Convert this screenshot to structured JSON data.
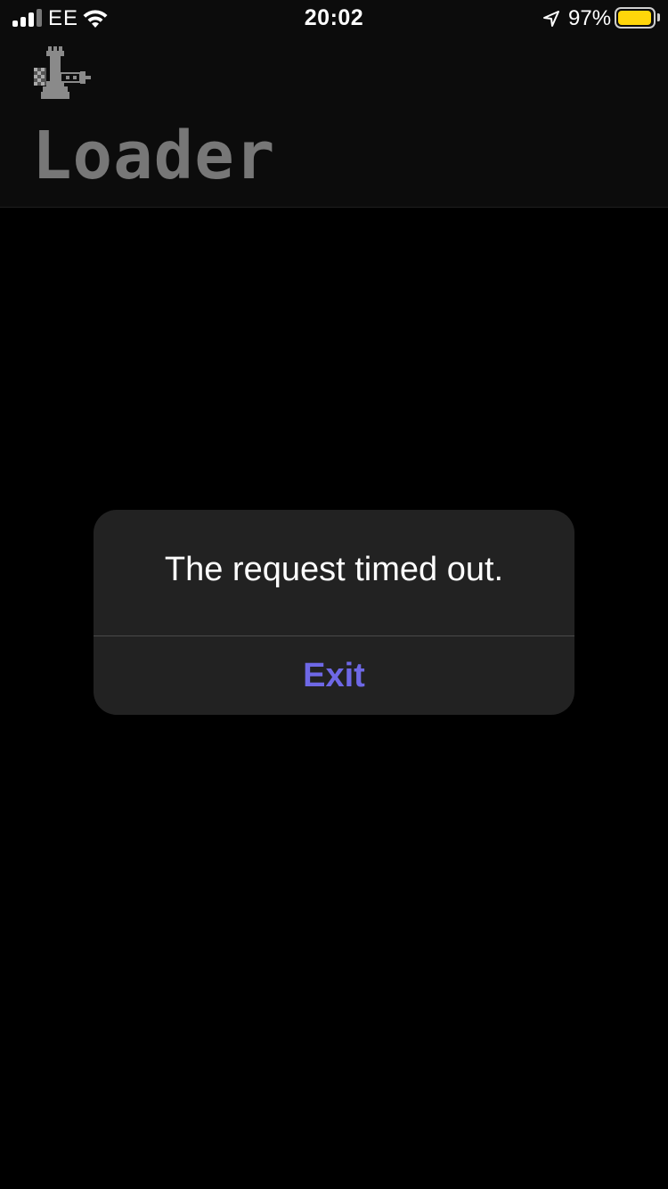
{
  "status_bar": {
    "carrier": "EE",
    "time": "20:02",
    "battery_percent": "97%",
    "battery_level": 0.97,
    "signal_bars": 3,
    "icons": [
      "signal-icon",
      "wifi-icon",
      "location-arrow-icon",
      "battery-icon"
    ]
  },
  "header": {
    "logo_icon": "chess-rook-cannon-icon",
    "title": "Loader"
  },
  "alert": {
    "message": "The request timed out.",
    "exit_label": "Exit"
  },
  "colors": {
    "background": "#000000",
    "header_background": "#0c0c0c",
    "title": "#777777",
    "alert_background": "#222222",
    "accent": "#6e68e6",
    "battery": "#ffd60a"
  }
}
